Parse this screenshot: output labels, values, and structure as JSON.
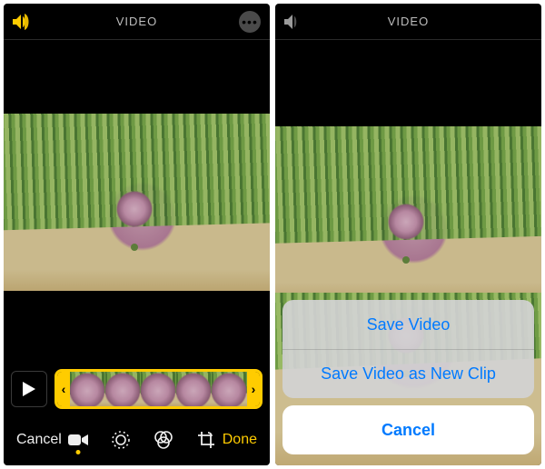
{
  "left": {
    "title": "VIDEO",
    "volume_state": "on",
    "timeline": {
      "frames": 5
    },
    "toolbar": {
      "cancel": "Cancel",
      "done": "Done",
      "active_tool": "video"
    }
  },
  "right": {
    "title": "VIDEO",
    "volume_state": "muted",
    "action_sheet": {
      "options": [
        {
          "label": "Save Video"
        },
        {
          "label": "Save Video as New Clip"
        }
      ],
      "cancel": "Cancel"
    }
  },
  "colors": {
    "accent": "#ffcc00",
    "ios_blue": "#007aff"
  }
}
